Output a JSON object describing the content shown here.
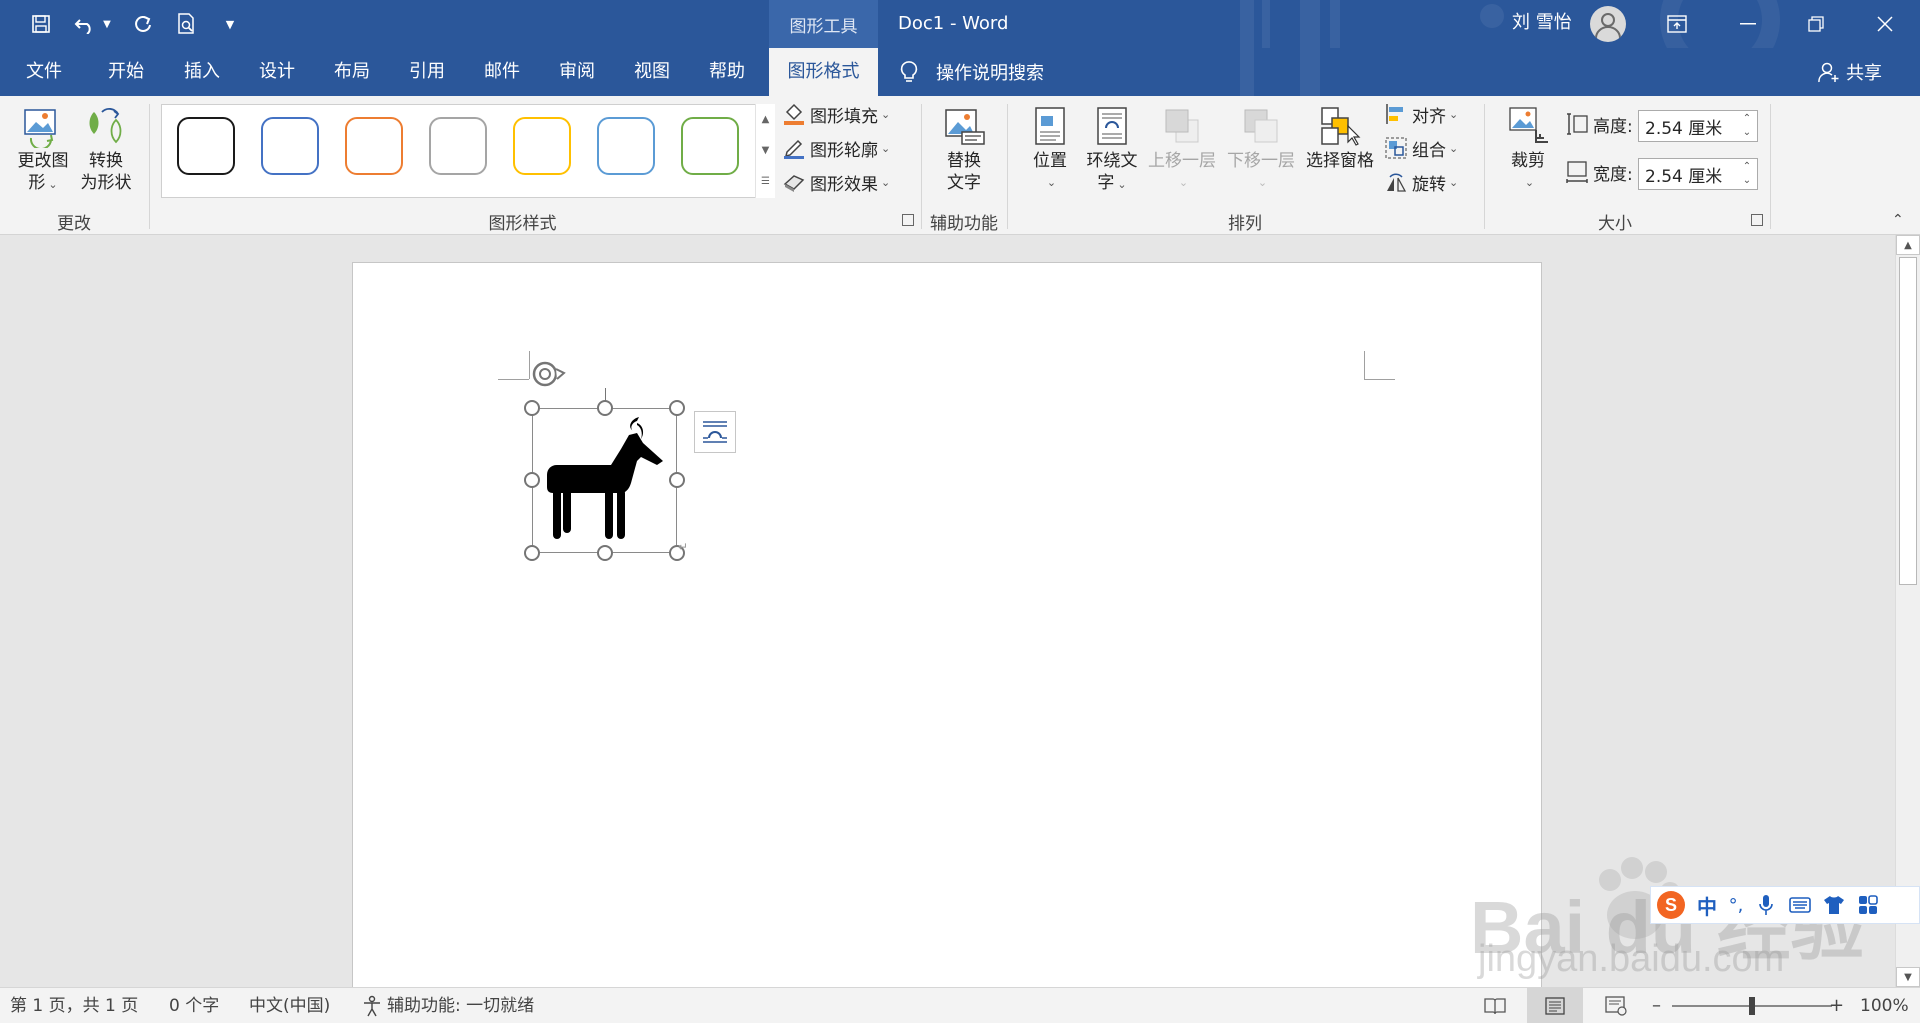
{
  "titlebar": {
    "context_tab": "图形工具",
    "document_title": "Doc1  -  Word",
    "user_name": "刘 雪怡",
    "quick_access": [
      "save-icon",
      "undo-icon",
      "redo-icon",
      "print-preview-icon",
      "customize-icon"
    ]
  },
  "tabs": [
    "文件",
    "开始",
    "插入",
    "设计",
    "布局",
    "引用",
    "邮件",
    "审阅",
    "视图",
    "帮助",
    "图形格式"
  ],
  "active_tab": "图形格式",
  "tell_me": "操作说明搜索",
  "share": "共享",
  "ribbon": {
    "change_group": {
      "label": "更改",
      "change_graphic_line1": "更改图",
      "change_graphic_line2": "形",
      "convert_line1": "转换",
      "convert_line2": "为形状"
    },
    "styles_group": {
      "label": "图形样式",
      "swatch_colors": [
        "#1a1a1a",
        "#4472c4",
        "#ed7d31",
        "#a5a5a5",
        "#ffc000",
        "#5b9bd5",
        "#70ad47"
      ],
      "fill": "图形填充",
      "outline": "图形轮廓",
      "effects": "图形效果"
    },
    "accessibility_group": {
      "label": "辅助功能",
      "alt_text_line1": "替换",
      "alt_text_line2": "文字"
    },
    "arrange_group": {
      "label": "排列",
      "position": "位置",
      "wrap_line1": "环绕文",
      "wrap_line2": "字",
      "bring_forward": "上移一层",
      "send_backward": "下移一层",
      "selection_pane": "选择窗格",
      "align": "对齐",
      "group": "组合",
      "rotate": "旋转"
    },
    "size_group": {
      "label": "大小",
      "crop": "裁剪",
      "height_label": "高度:",
      "height_value": "2.54 厘米",
      "width_label": "宽度:",
      "width_value": "2.54 厘米"
    }
  },
  "statusbar": {
    "page": "第 1 页，共 1 页",
    "words": "0 个字",
    "language": "中文(中国)",
    "accessibility": "辅助功能: 一切就绪",
    "zoom": "100%",
    "zoom_level": 1.0
  },
  "ime": {
    "mode": "中"
  },
  "watermark": {
    "brand": "Bai du 经验",
    "url": "jingyan.baidu.com"
  },
  "colors": {
    "title_bar": "#2b579a",
    "active_tab_bg": "#f3f3f3",
    "accent": "#2b579a"
  }
}
